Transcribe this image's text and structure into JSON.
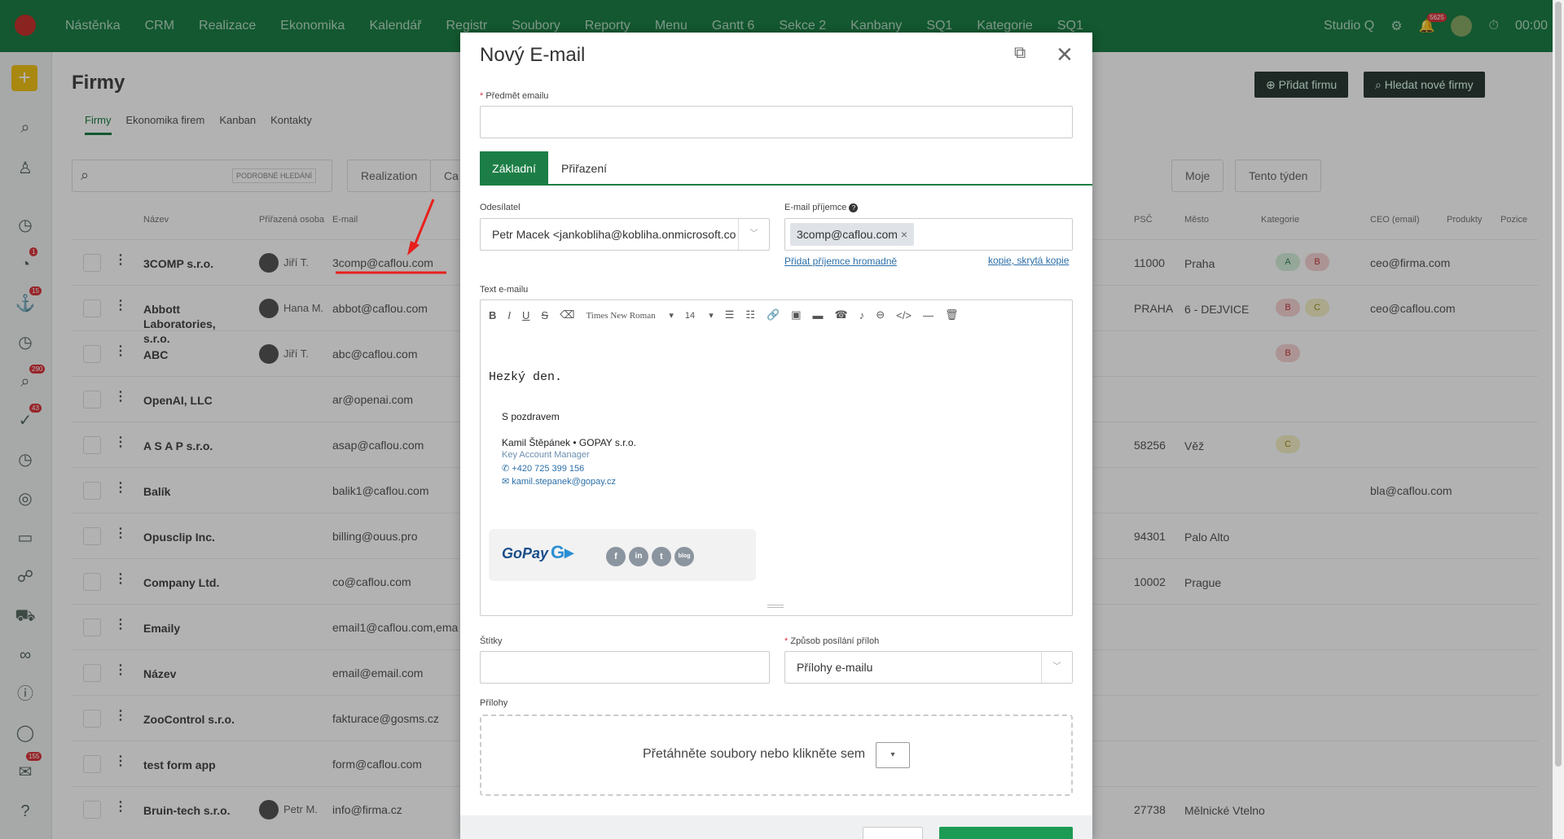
{
  "topnav": {
    "items": [
      "Nástěnka",
      "CRM",
      "Realizace",
      "Ekonomika",
      "Kalendář",
      "Registr",
      "Soubory",
      "Reporty",
      "Menu",
      "Gantt 6",
      "Sekce 2",
      "Kanbany",
      "SQ1",
      "Kategorie",
      "SQ1"
    ],
    "studio": "Studio Q",
    "notif_count": "5625",
    "timer": "00:00"
  },
  "sidebar": {
    "badges": [
      "1",
      "15",
      "290",
      "43",
      "155"
    ]
  },
  "page": {
    "title": "Firmy",
    "tabs": [
      "Firmy",
      "Ekonomika firem",
      "Kanban",
      "Kontakty"
    ],
    "add_button": "Přidat firmu",
    "find_button": "Hledat nové firmy",
    "advanced_search": "PODROBNÉ HLEDÁNÍ",
    "filters": [
      "Realization",
      "Ca",
      "Moje",
      "Tento týden"
    ]
  },
  "table": {
    "headers": {
      "name": "Název",
      "person": "Přiřazená osoba",
      "email": "E-mail",
      "psc": "PSČ",
      "city": "Město",
      "category": "Kategorie",
      "ceo": "CEO (email)",
      "products": "Produkty",
      "position": "Pozice"
    },
    "rows": [
      {
        "name": "3COMP s.r.o.",
        "person": "Jiří T.",
        "email": "3comp@caflou.com",
        "psc": "11000",
        "city": "Praha",
        "ceo": "ceo@firma.com",
        "cats": [
          "A",
          "B"
        ]
      },
      {
        "name": "Abbott Laboratories, s.r.o.",
        "person": "Hana M.",
        "email": "abbot@caflou.com",
        "psc": "PRAHA",
        "city": "6 - DEJVICE",
        "ceo": "ceo@caflou.com",
        "cats": [
          "B",
          "C"
        ]
      },
      {
        "name": "ABC",
        "person": "Jiří T.",
        "email": "abc@caflou.com",
        "psc": "",
        "city": "",
        "ceo": "",
        "cats": [
          "B"
        ]
      },
      {
        "name": "OpenAI, LLC",
        "person": "",
        "email": "ar@openai.com",
        "psc": "",
        "city": "",
        "ceo": "",
        "cats": []
      },
      {
        "name": "A S A P s.r.o.",
        "person": "",
        "email": "asap@caflou.com",
        "psc": "58256",
        "city": "Věž",
        "ceo": "",
        "cats": [
          "C"
        ]
      },
      {
        "name": "Balík",
        "person": "",
        "email": "balik1@caflou.com",
        "psc": "",
        "city": "",
        "ceo": "bla@caflou.com",
        "cats": []
      },
      {
        "name": "Opusclip Inc.",
        "person": "",
        "email": "billing@ouus.pro",
        "psc": "94301",
        "city": "Palo Alto",
        "ceo": "",
        "cats": []
      },
      {
        "name": "Company Ltd.",
        "person": "",
        "email": "co@caflou.com",
        "psc": "10002",
        "city": "Prague",
        "ceo": "",
        "cats": []
      },
      {
        "name": "Emaily",
        "person": "",
        "email": "email1@caflou.com,ema",
        "psc": "",
        "city": "",
        "ceo": "",
        "cats": []
      },
      {
        "name": "Název",
        "person": "",
        "email": "email@email.com",
        "psc": "",
        "city": "",
        "ceo": "",
        "cats": []
      },
      {
        "name": "ZooControl s.r.o.",
        "person": "",
        "email": "fakturace@gosms.cz",
        "psc": "",
        "city": "",
        "ceo": "",
        "cats": []
      },
      {
        "name": "test form app",
        "person": "",
        "email": "form@caflou.com",
        "psc": "",
        "city": "",
        "ceo": "",
        "cats": []
      },
      {
        "name": "Bruin-tech s.r.o.",
        "person": "Petr M.",
        "email": "info@firma.cz",
        "psc": "27738",
        "city": "Mělnické Vtelno",
        "ceo": "",
        "cats": []
      }
    ]
  },
  "modal": {
    "title": "Nový E-mail",
    "subject_label": "Předmět emailu",
    "subject_value": "",
    "tabs": [
      "Základní",
      "Přiřazení"
    ],
    "sender_label": "Odesílatel",
    "sender_value": "Petr Macek <jankobliha@kobliha.onmicrosoft.co",
    "recipient_label": "E-mail příjemce",
    "recipient_tag": "3comp@caflou.com",
    "bulk_link": "Přidat příjemce hromadně",
    "copy_link": "kopie, skrytá kopie",
    "body_label": "Text e-mailu",
    "font_name": "Times New Roman",
    "font_size": "14",
    "body": {
      "greeting": "Hezký den.",
      "regards": "S pozdravem",
      "signer": "Kamil Štěpánek • GOPAY s.r.o.",
      "role": "Key Account Manager",
      "phone": "+420 725 399 156",
      "mail": "kamil.stepanek@gopay.cz",
      "logo": "GoPay",
      "social": [
        "f",
        "in",
        "t",
        "blog"
      ]
    },
    "tags_label": "Štítky",
    "attach_mode_label": "Způsob posílání příloh",
    "attach_mode_value": "Přílohy e-mailu",
    "attachments_label": "Přílohy",
    "drop_text": "Přetáhněte soubory nebo klikněte sem"
  }
}
